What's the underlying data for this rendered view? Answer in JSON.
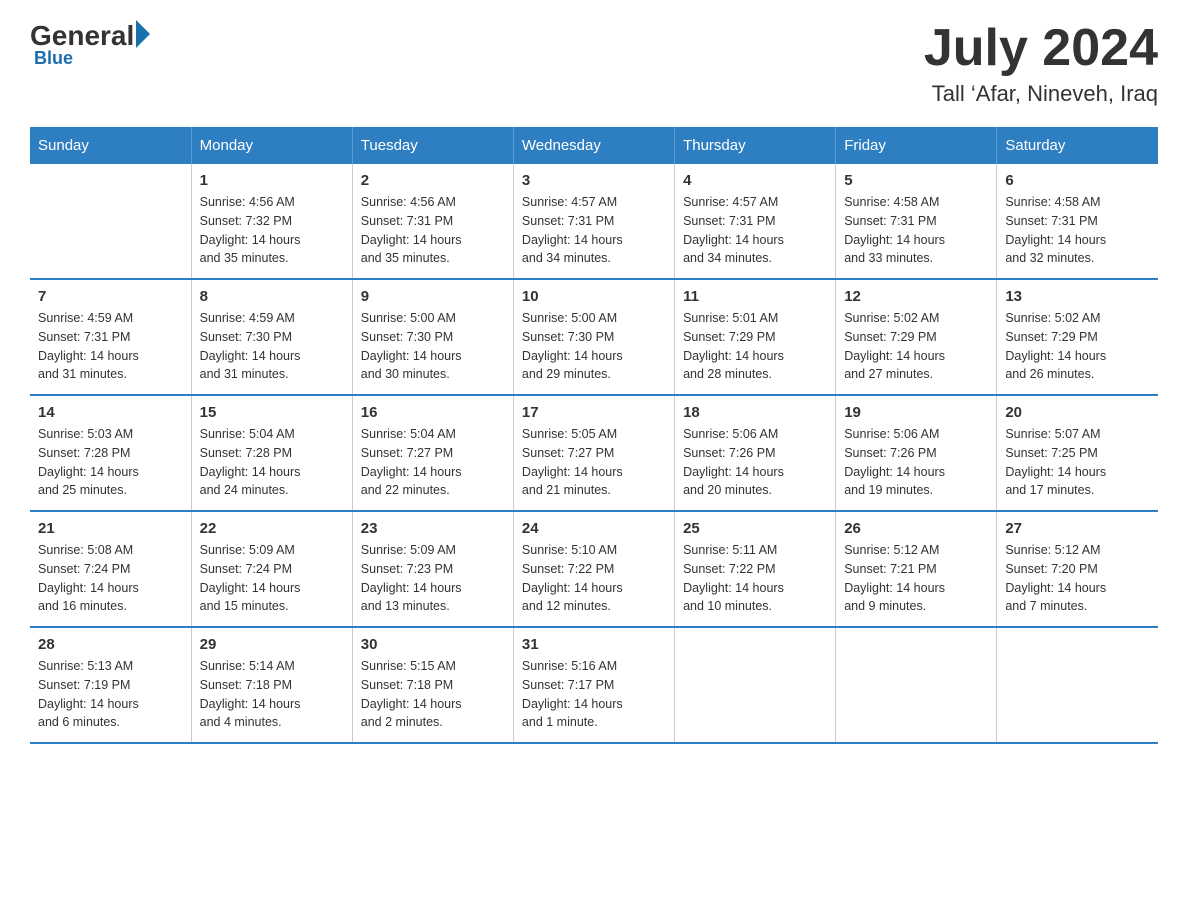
{
  "logo": {
    "general": "General",
    "blue": "Blue"
  },
  "header": {
    "month": "July 2024",
    "location": "Tall ‘Afar, Nineveh, Iraq"
  },
  "days_of_week": [
    "Sunday",
    "Monday",
    "Tuesday",
    "Wednesday",
    "Thursday",
    "Friday",
    "Saturday"
  ],
  "weeks": [
    [
      {
        "day": "",
        "info": ""
      },
      {
        "day": "1",
        "info": "Sunrise: 4:56 AM\nSunset: 7:32 PM\nDaylight: 14 hours\nand 35 minutes."
      },
      {
        "day": "2",
        "info": "Sunrise: 4:56 AM\nSunset: 7:31 PM\nDaylight: 14 hours\nand 35 minutes."
      },
      {
        "day": "3",
        "info": "Sunrise: 4:57 AM\nSunset: 7:31 PM\nDaylight: 14 hours\nand 34 minutes."
      },
      {
        "day": "4",
        "info": "Sunrise: 4:57 AM\nSunset: 7:31 PM\nDaylight: 14 hours\nand 34 minutes."
      },
      {
        "day": "5",
        "info": "Sunrise: 4:58 AM\nSunset: 7:31 PM\nDaylight: 14 hours\nand 33 minutes."
      },
      {
        "day": "6",
        "info": "Sunrise: 4:58 AM\nSunset: 7:31 PM\nDaylight: 14 hours\nand 32 minutes."
      }
    ],
    [
      {
        "day": "7",
        "info": "Sunrise: 4:59 AM\nSunset: 7:31 PM\nDaylight: 14 hours\nand 31 minutes."
      },
      {
        "day": "8",
        "info": "Sunrise: 4:59 AM\nSunset: 7:30 PM\nDaylight: 14 hours\nand 31 minutes."
      },
      {
        "day": "9",
        "info": "Sunrise: 5:00 AM\nSunset: 7:30 PM\nDaylight: 14 hours\nand 30 minutes."
      },
      {
        "day": "10",
        "info": "Sunrise: 5:00 AM\nSunset: 7:30 PM\nDaylight: 14 hours\nand 29 minutes."
      },
      {
        "day": "11",
        "info": "Sunrise: 5:01 AM\nSunset: 7:29 PM\nDaylight: 14 hours\nand 28 minutes."
      },
      {
        "day": "12",
        "info": "Sunrise: 5:02 AM\nSunset: 7:29 PM\nDaylight: 14 hours\nand 27 minutes."
      },
      {
        "day": "13",
        "info": "Sunrise: 5:02 AM\nSunset: 7:29 PM\nDaylight: 14 hours\nand 26 minutes."
      }
    ],
    [
      {
        "day": "14",
        "info": "Sunrise: 5:03 AM\nSunset: 7:28 PM\nDaylight: 14 hours\nand 25 minutes."
      },
      {
        "day": "15",
        "info": "Sunrise: 5:04 AM\nSunset: 7:28 PM\nDaylight: 14 hours\nand 24 minutes."
      },
      {
        "day": "16",
        "info": "Sunrise: 5:04 AM\nSunset: 7:27 PM\nDaylight: 14 hours\nand 22 minutes."
      },
      {
        "day": "17",
        "info": "Sunrise: 5:05 AM\nSunset: 7:27 PM\nDaylight: 14 hours\nand 21 minutes."
      },
      {
        "day": "18",
        "info": "Sunrise: 5:06 AM\nSunset: 7:26 PM\nDaylight: 14 hours\nand 20 minutes."
      },
      {
        "day": "19",
        "info": "Sunrise: 5:06 AM\nSunset: 7:26 PM\nDaylight: 14 hours\nand 19 minutes."
      },
      {
        "day": "20",
        "info": "Sunrise: 5:07 AM\nSunset: 7:25 PM\nDaylight: 14 hours\nand 17 minutes."
      }
    ],
    [
      {
        "day": "21",
        "info": "Sunrise: 5:08 AM\nSunset: 7:24 PM\nDaylight: 14 hours\nand 16 minutes."
      },
      {
        "day": "22",
        "info": "Sunrise: 5:09 AM\nSunset: 7:24 PM\nDaylight: 14 hours\nand 15 minutes."
      },
      {
        "day": "23",
        "info": "Sunrise: 5:09 AM\nSunset: 7:23 PM\nDaylight: 14 hours\nand 13 minutes."
      },
      {
        "day": "24",
        "info": "Sunrise: 5:10 AM\nSunset: 7:22 PM\nDaylight: 14 hours\nand 12 minutes."
      },
      {
        "day": "25",
        "info": "Sunrise: 5:11 AM\nSunset: 7:22 PM\nDaylight: 14 hours\nand 10 minutes."
      },
      {
        "day": "26",
        "info": "Sunrise: 5:12 AM\nSunset: 7:21 PM\nDaylight: 14 hours\nand 9 minutes."
      },
      {
        "day": "27",
        "info": "Sunrise: 5:12 AM\nSunset: 7:20 PM\nDaylight: 14 hours\nand 7 minutes."
      }
    ],
    [
      {
        "day": "28",
        "info": "Sunrise: 5:13 AM\nSunset: 7:19 PM\nDaylight: 14 hours\nand 6 minutes."
      },
      {
        "day": "29",
        "info": "Sunrise: 5:14 AM\nSunset: 7:18 PM\nDaylight: 14 hours\nand 4 minutes."
      },
      {
        "day": "30",
        "info": "Sunrise: 5:15 AM\nSunset: 7:18 PM\nDaylight: 14 hours\nand 2 minutes."
      },
      {
        "day": "31",
        "info": "Sunrise: 5:16 AM\nSunset: 7:17 PM\nDaylight: 14 hours\nand 1 minute."
      },
      {
        "day": "",
        "info": ""
      },
      {
        "day": "",
        "info": ""
      },
      {
        "day": "",
        "info": ""
      }
    ]
  ]
}
